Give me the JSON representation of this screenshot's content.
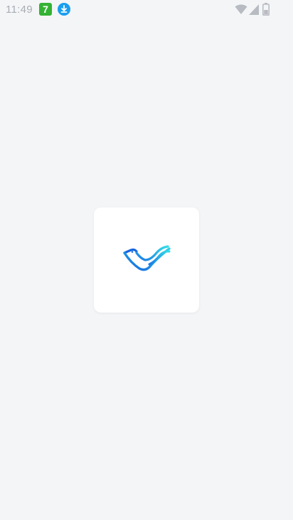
{
  "status_bar": {
    "time": "11:49",
    "notification_badge": "7",
    "icons": [
      "download-icon",
      "wifi-icon",
      "signal-icon",
      "battery-icon"
    ]
  },
  "splash": {
    "logo": "bird-wave-logo-icon"
  },
  "colors": {
    "background": "#f4f5f7",
    "card": "#ffffff",
    "badge_green": "#34b233",
    "download_blue": "#1a9ef0",
    "logo_dark_blue": "#1565e0",
    "logo_cyan": "#2ed3e8",
    "status_grey": "#a8adb3"
  }
}
